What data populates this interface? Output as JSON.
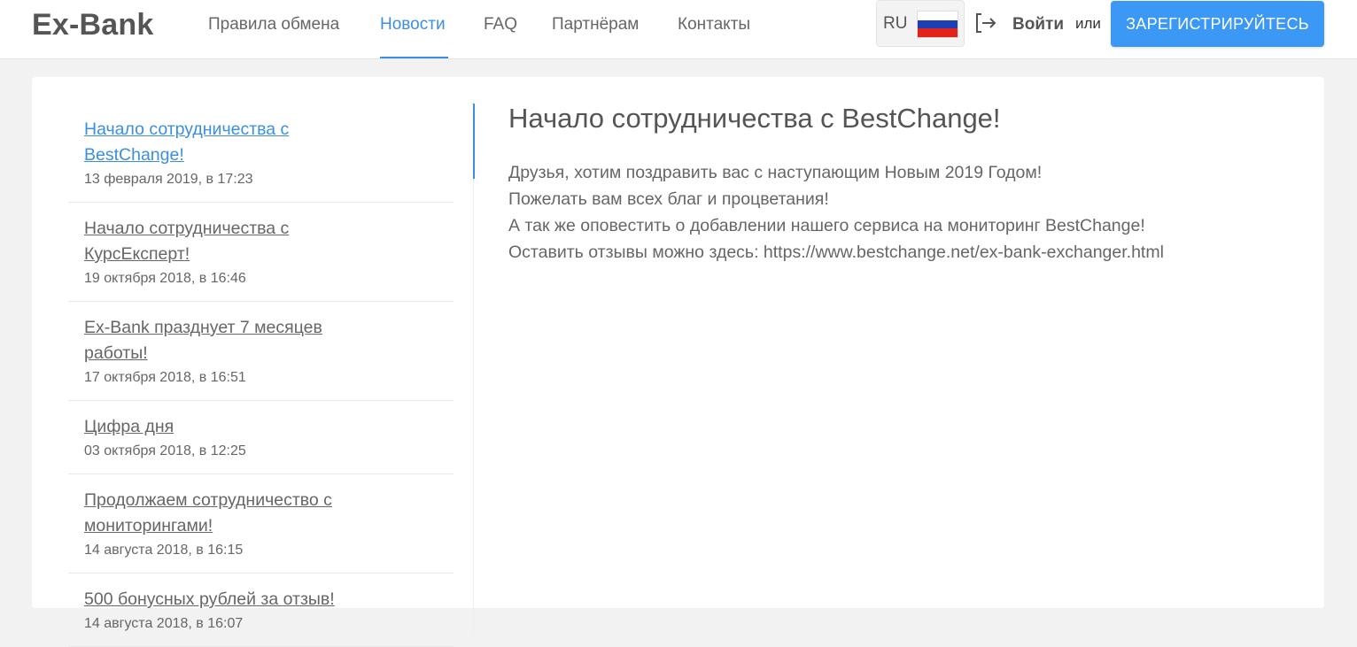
{
  "header": {
    "logo": "Ex-Bank",
    "nav": [
      {
        "label": "Правила обмена",
        "active": false
      },
      {
        "label": "Новости",
        "active": true
      },
      {
        "label": "FAQ",
        "active": false
      },
      {
        "label": "Партнёрам",
        "active": false
      },
      {
        "label": "Контакты",
        "active": false
      }
    ],
    "language": "RU",
    "login_icon": "login-arrow-icon",
    "login_label": "Войти",
    "or_label": "или",
    "register_label": "ЗАРЕГИСТРИРУЙТЕСЬ"
  },
  "news": [
    {
      "title": "Начало сотрудничества с BestChange!",
      "date": "13 февраля 2019, в 17:23",
      "active": true
    },
    {
      "title": "Начало сотрудничества с КурсЕксперт!",
      "date": "19 октября 2018, в 16:46",
      "active": false
    },
    {
      "title": "Ex-Bank празднует 7 месяцев работы!",
      "date": "17 октября 2018, в 16:51",
      "active": false
    },
    {
      "title": "Цифра дня",
      "date": "03 октября 2018, в 12:25",
      "active": false
    },
    {
      "title": "Продолжаем сотрудничество с мониторингами!",
      "date": "14 августа 2018, в 16:15",
      "active": false
    },
    {
      "title": "500 бонусных рублей за отзыв!",
      "date": "14 августа 2018, в 16:07",
      "active": false
    }
  ],
  "article": {
    "title": "Начало сотрудничества с BestChange!",
    "paragraphs": [
      "Друзья, хотим поздравить вас с наступающим Новым 2019 Годом!",
      "Пожелать вам всех благ и процветания!",
      "А так же оповестить о добавлении нашего сервиса на мониторинг BestChange!",
      "Оставить отзывы можно здесь: https://www.bestchange.net/ex-bank-exchanger.html"
    ]
  },
  "colors": {
    "accent": "#3b8fe0",
    "register_button": "#3c98f5",
    "background": "#f2f2f2",
    "text": "#555555"
  }
}
